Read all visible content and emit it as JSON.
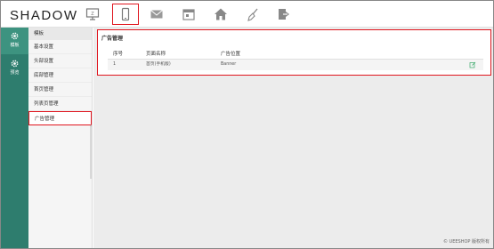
{
  "app": {
    "logo": "SHADOW"
  },
  "top_icons": [
    {
      "name": "monitor-icon",
      "active": false
    },
    {
      "name": "mobile-icon",
      "active": true
    },
    {
      "name": "mail-icon",
      "active": false
    },
    {
      "name": "calendar-icon",
      "active": false
    },
    {
      "name": "home-icon",
      "active": false
    },
    {
      "name": "broom-icon",
      "active": false
    },
    {
      "name": "logout-icon",
      "active": false
    }
  ],
  "leftbar": {
    "items": [
      {
        "label": "模板",
        "icon": "gear-icon",
        "active": true
      },
      {
        "label": "预览",
        "icon": "gear-icon",
        "active": false
      }
    ]
  },
  "sidebar": {
    "header": "模板",
    "items": [
      {
        "label": "基本设置"
      },
      {
        "label": "头部设置"
      },
      {
        "label": "底部管理"
      },
      {
        "label": "首页管理"
      },
      {
        "label": "列表页管理"
      },
      {
        "label": "广告管理",
        "active": true
      }
    ]
  },
  "panel": {
    "title": "广告管理",
    "columns": [
      "序号",
      "页面名称",
      "广告位置"
    ],
    "rows": [
      {
        "index": "1",
        "page": "首页(手机版)",
        "position": "Banner",
        "action_icon": "edit-icon"
      }
    ]
  },
  "footer": "© UEESHOP 版权所有",
  "colors": {
    "accent": "#2e7d6e",
    "highlight": "#e0151e"
  }
}
